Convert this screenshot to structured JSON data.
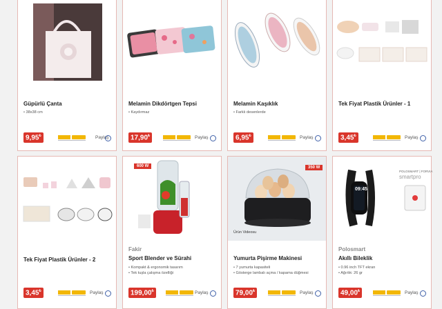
{
  "taksit_label": "6 TAKSİT",
  "paylas_label": "Paylaş",
  "products": [
    {
      "title": "Güpürlü Çanta",
      "brand": "",
      "features": [
        "• 38x38 cm"
      ],
      "price": "9,95",
      "currency": "₺",
      "watt": "",
      "badge": ""
    },
    {
      "title": "Melamin Dikdörtgen Tepsi",
      "brand": "",
      "features": [
        "• Kaydırmaz"
      ],
      "price": "17,90",
      "currency": "₺",
      "watt": "",
      "badge": ""
    },
    {
      "title": "Melamin Kaşıklık",
      "brand": "",
      "features": [
        "• Farklı desenlerde"
      ],
      "price": "6,95",
      "currency": "₺",
      "watt": "",
      "badge": ""
    },
    {
      "title": "Tek Fiyat Plastik Ürünler - 1",
      "brand": "",
      "features": [],
      "price": "3,45",
      "currency": "₺",
      "watt": "",
      "badge": ""
    },
    {
      "title": "Tek Fiyat Plastik Ürünler - 2",
      "brand": "",
      "features": [],
      "price": "3,45",
      "currency": "₺",
      "watt": "",
      "badge": ""
    },
    {
      "title": "Sport Blender ve Sürahi",
      "brand": "Fakir",
      "features": [
        "• Kompakt & ergonomik tasarım",
        "• Tek tuşla çalışma özelliği"
      ],
      "price": "199,00",
      "currency": "₺",
      "watt": "600 W",
      "badge": "fakir"
    },
    {
      "title": "Yumurta Pişirme Makinesi",
      "brand": "",
      "features": [
        "• 7 yumurta kapasiteli",
        "• Gösterge lambalı açma / kapama düğmesi"
      ],
      "price": "79,00",
      "currency": "₺",
      "watt": "350 W",
      "badge": "Ürün Videosu"
    },
    {
      "title": "Akıllı Bileklik",
      "brand": "Polosmart",
      "features": [
        "• 0.96 inch TFT ekran",
        "• Ağırlık: 26 gr"
      ],
      "price": "49,00",
      "currency": "₺",
      "watt": "",
      "badge": ""
    }
  ],
  "watch_promo": {
    "brand": "POLOSMART | FORVIA",
    "model": "smartpro",
    "time": "09:45"
  }
}
